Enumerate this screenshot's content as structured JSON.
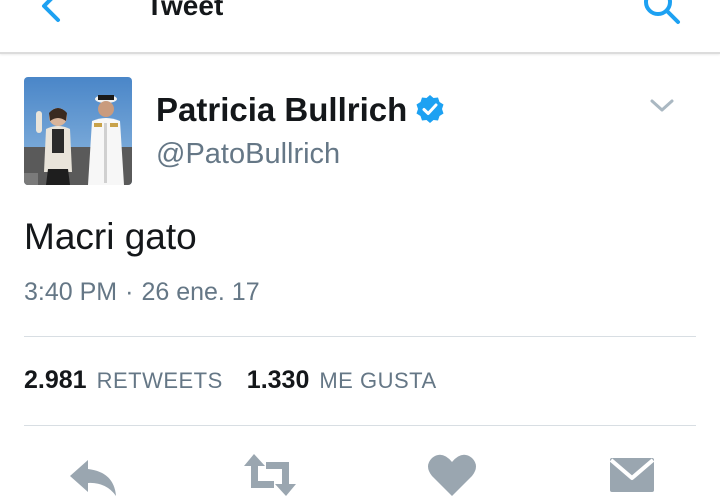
{
  "header": {
    "title": "Tweet",
    "back_icon": "back-arrow-icon",
    "search_icon": "search-icon"
  },
  "colors": {
    "accent": "#1da1f2",
    "secondary_text": "#657786",
    "primary_text": "#14171a",
    "divider": "#d8dee3",
    "action_icons": "#9aa6b0"
  },
  "tweet": {
    "author_name": "Patricia Bullrich",
    "handle": "@PatoBullrich",
    "verified_icon": "verified-badge-icon",
    "menu_icon": "chevron-down-icon",
    "text": "Macri gato",
    "time": "3:40 PM",
    "separator": "·",
    "date": "26 ene. 17"
  },
  "stats": {
    "retweets_count": "2.981",
    "retweets_label": "RETWEETS",
    "likes_count": "1.330",
    "likes_label": "ME GUSTA"
  },
  "actions": [
    {
      "icon": "reply-icon"
    },
    {
      "icon": "retweet-icon"
    },
    {
      "icon": "heart-icon"
    },
    {
      "icon": "message-icon"
    }
  ]
}
